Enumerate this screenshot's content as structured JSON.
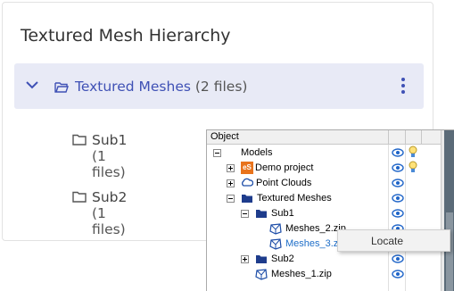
{
  "card": {
    "title": "Textured Mesh Hierarchy",
    "selected_row": {
      "label": "Textured Meshes",
      "count": "(2 files)"
    },
    "children": [
      {
        "label": "Sub1",
        "count": "(1 files)"
      },
      {
        "label": "Sub2",
        "count": "(1 files)"
      }
    ]
  },
  "tree": {
    "header": "Object",
    "rows": [
      {
        "label": "Models"
      },
      {
        "label": "Demo project",
        "badge": "eS"
      },
      {
        "label": "Point Clouds"
      },
      {
        "label": "Textured Meshes"
      },
      {
        "label": "Sub1"
      },
      {
        "label": "Meshes_2.zip"
      },
      {
        "label": "Meshes_3.zip"
      },
      {
        "label": "Sub2"
      },
      {
        "label": "Meshes_1.zip"
      }
    ]
  },
  "context_menu": {
    "item": "Locate"
  },
  "colors": {
    "accent": "#3f51b5",
    "selected_bg": "#e8eaf6",
    "eye": "#1e64c8",
    "badge": "#e8731c"
  }
}
